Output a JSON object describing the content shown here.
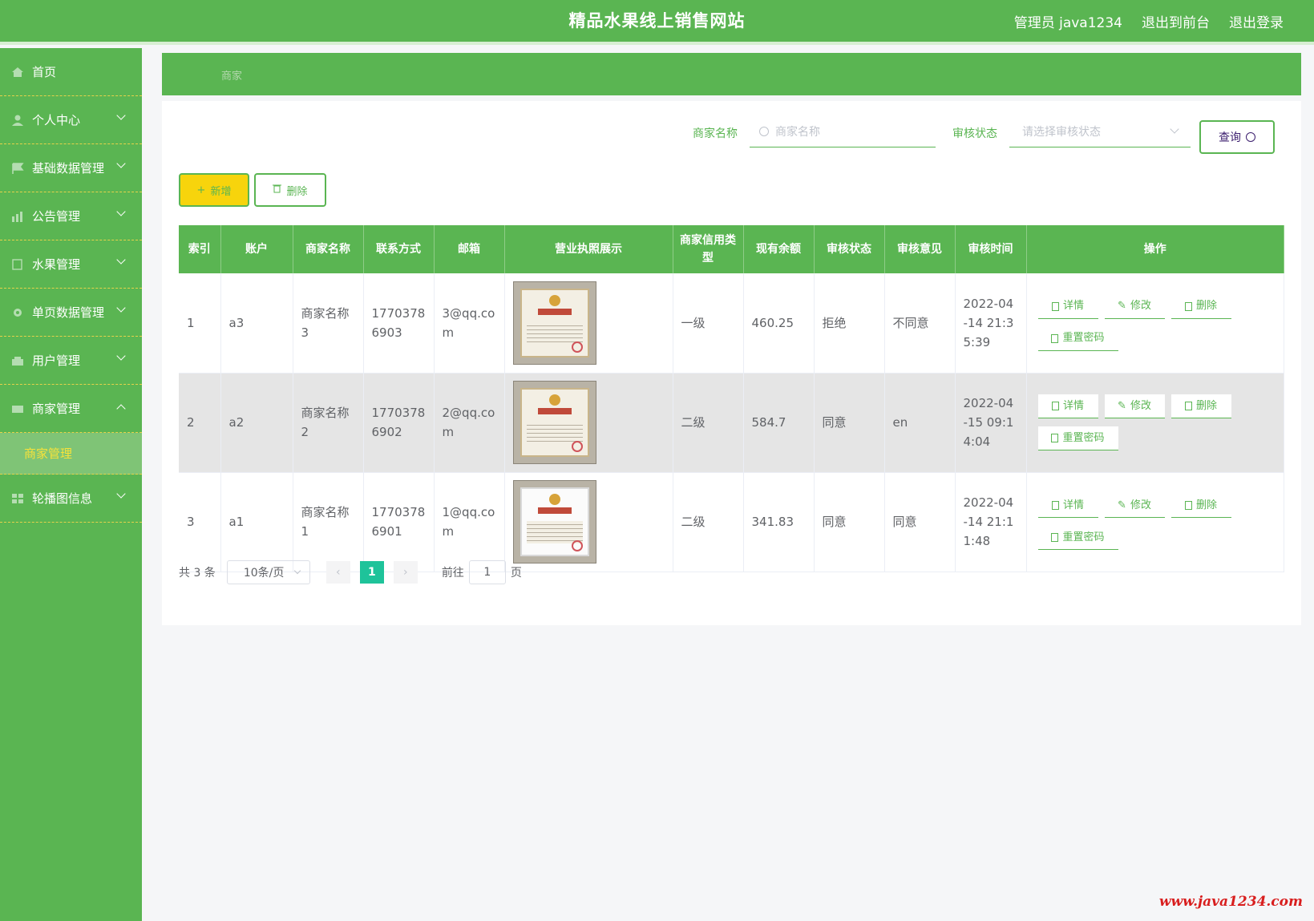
{
  "header": {
    "title": "精品水果线上销售网站",
    "user": "管理员 java1234",
    "to_front": "退出到前台",
    "logout": "退出登录"
  },
  "sidebar": {
    "items": [
      {
        "label": "首页"
      },
      {
        "label": "个人中心"
      },
      {
        "label": "基础数据管理"
      },
      {
        "label": "公告管理"
      },
      {
        "label": "水果管理"
      },
      {
        "label": "单页数据管理"
      },
      {
        "label": "用户管理"
      },
      {
        "label": "商家管理"
      },
      {
        "label": "轮播图信息"
      }
    ],
    "active_sub": "商家管理"
  },
  "breadcrumb": "商家",
  "search": {
    "name_label": "商家名称",
    "name_placeholder": "商家名称",
    "status_label": "审核状态",
    "status_placeholder": "请选择审核状态",
    "query_label": "查询"
  },
  "actions": {
    "add_label": "新增",
    "delete_label": "删除"
  },
  "table": {
    "headers": [
      "索引",
      "账户",
      "商家名称",
      "联系方式",
      "邮箱",
      "营业执照展示",
      "商家信用类型",
      "现有余额",
      "审核状态",
      "审核意见",
      "审核时间",
      "操作"
    ],
    "rows": [
      {
        "index": "1",
        "account": "a3",
        "name": "商家名称3",
        "phone": "17703786903",
        "email": "3@qq.com",
        "credit": "一级",
        "balance": "460.25",
        "status": "拒绝",
        "opinion": "不同意",
        "time": "2022-04-14 21:35:39"
      },
      {
        "index": "2",
        "account": "a2",
        "name": "商家名称2",
        "phone": "17703786902",
        "email": "2@qq.com",
        "credit": "二级",
        "balance": "584.7",
        "status": "同意",
        "opinion": "en",
        "time": "2022-04-15 09:14:04"
      },
      {
        "index": "3",
        "account": "a1",
        "name": "商家名称1",
        "phone": "17703786901",
        "email": "1@qq.com",
        "credit": "二级",
        "balance": "341.83",
        "status": "同意",
        "opinion": "同意",
        "time": "2022-04-14 21:11:48"
      }
    ],
    "op_labels": {
      "detail": "详情",
      "edit": "修改",
      "delete": "删除",
      "reset": "重置密码"
    }
  },
  "pager": {
    "total": "共 3 条",
    "page_size": "10条/页",
    "current": "1",
    "goto": "前往",
    "jump_value": "1",
    "page_suffix": "页"
  },
  "watermark": "www.java1234.com",
  "colors": {
    "primary": "#5ab552",
    "accent_yellow": "#f7d40c",
    "page_active": "#1ec39a"
  }
}
